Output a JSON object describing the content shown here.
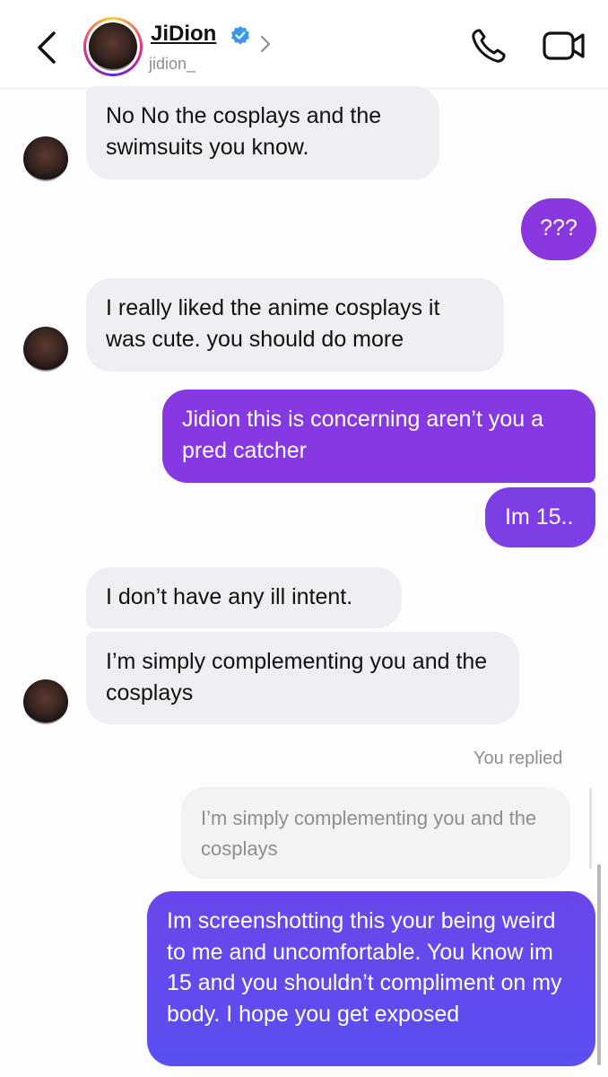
{
  "header": {
    "name": "JiDion",
    "handle": "jidion_",
    "icons": [
      "back-chevron-icon",
      "verified-badge-icon",
      "chevron-right-icon",
      "phone-call-icon",
      "video-call-icon"
    ]
  },
  "messages": {
    "m1": "No No the cosplays and the swimsuits you know.",
    "m2": "???",
    "m3": "I really liked the anime cosplays it was cute. you should do more",
    "m4": "Jidion this is concerning aren’t you a pred catcher",
    "m5": "Im 15..",
    "m6": "I don’t have any ill intent.",
    "m7": "I’m simply complementing you and the cosplays",
    "reply_label": "You replied",
    "quoted": "I’m simply complementing you and the cosplays",
    "m8": "Im screenshotting this your being weird to me and uncomfortable. You know im 15 and you shouldn’t compliment on my body. I hope you get exposed"
  },
  "colors": {
    "incoming_bubble": "#efeff3",
    "outgoing_purple": "#8a3ae0",
    "outgoing_blue_purple": "#5b4cef",
    "verified_blue": "#3897f0"
  }
}
